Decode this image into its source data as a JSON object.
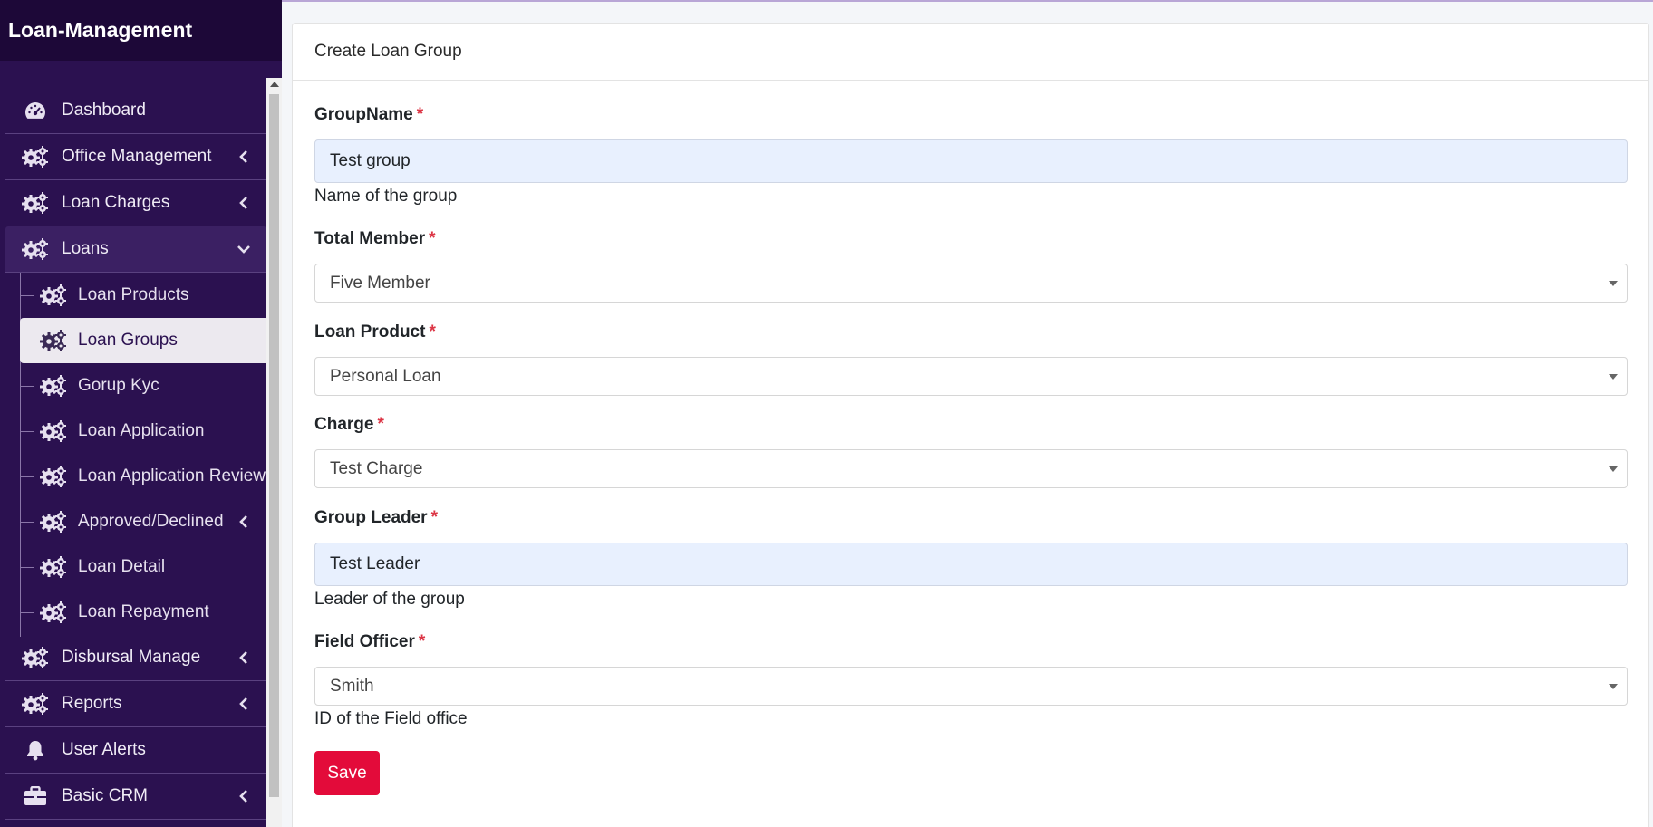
{
  "app": {
    "brand": "Loan-Management"
  },
  "sidebar": {
    "items": [
      {
        "label": "Dashboard",
        "icon": "dashboard-gauge-icon"
      },
      {
        "label": "Office Management",
        "icon": "cogs-icon"
      },
      {
        "label": "Loan Charges",
        "icon": "cogs-icon"
      },
      {
        "label": "Loans",
        "icon": "cogs-icon"
      },
      {
        "label": "Disbursal Manage",
        "icon": "cogs-icon"
      },
      {
        "label": "Reports",
        "icon": "cogs-icon"
      },
      {
        "label": "User Alerts",
        "icon": "bell-icon"
      },
      {
        "label": "Basic CRM",
        "icon": "briefcase-icon"
      }
    ],
    "loans_sub": [
      {
        "label": "Loan Products"
      },
      {
        "label": "Loan Groups"
      },
      {
        "label": "Gorup Kyc"
      },
      {
        "label": "Loan Application"
      },
      {
        "label": "Loan Application Review"
      },
      {
        "label": "Approved/Declined"
      },
      {
        "label": "Loan Detail"
      },
      {
        "label": "Loan Repayment"
      }
    ],
    "active_sub": "Loan Groups"
  },
  "form": {
    "title": "Create Loan Group",
    "required_mark": "*",
    "group_name": {
      "label": "GroupName",
      "value": "Test group",
      "help": "Name of the group"
    },
    "total_member": {
      "label": "Total Member",
      "value": "Five Member"
    },
    "loan_product": {
      "label": "Loan Product",
      "value": "Personal Loan"
    },
    "charge": {
      "label": "Charge",
      "value": "Test Charge"
    },
    "group_leader": {
      "label": "Group Leader",
      "value": "Test Leader",
      "help": "Leader of the group"
    },
    "field_officer": {
      "label": "Field Officer",
      "value": "Smith",
      "help": "ID of the Field office"
    },
    "save_label": "Save"
  },
  "colors": {
    "sidebar_bg": "#2b1150",
    "brand_bg": "#1d0838",
    "save_button": "#e30b3a",
    "required": "#dc3545",
    "autofill_bg": "#e8f0fe"
  }
}
